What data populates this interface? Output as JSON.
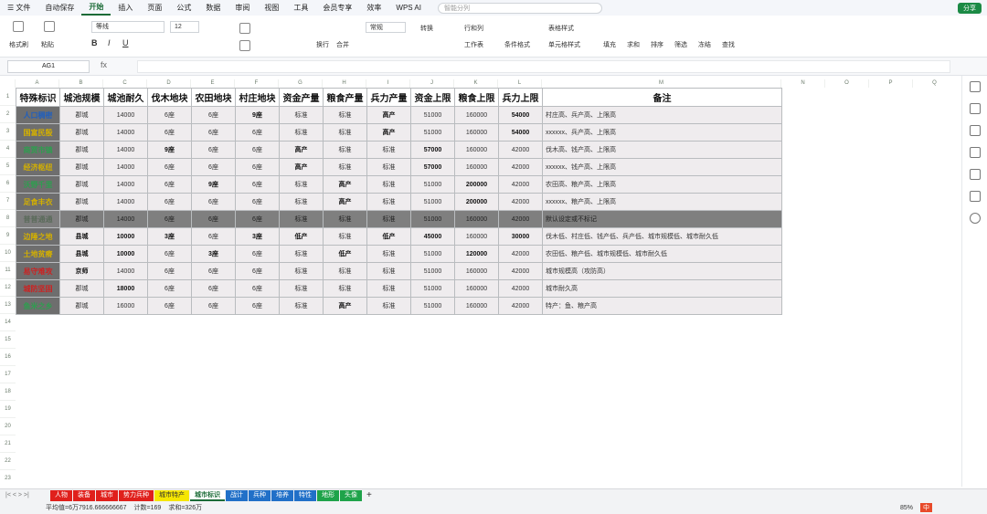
{
  "menubar": {
    "items": [
      "☰ 文件",
      "自动保存",
      "开始",
      "插入",
      "页面",
      "公式",
      "数据",
      "审阅",
      "视图",
      "工具",
      "会员专享",
      "效率",
      "WPS AI"
    ],
    "search_placeholder": "智能分列",
    "share_label": "分享"
  },
  "ribbon": {
    "format_painter": "格式刷",
    "paste": "粘贴",
    "font_name": "等线",
    "font_size": "12",
    "wrap": "换行",
    "merge": "合并",
    "number_format": "常规",
    "convert": "转换",
    "rows_cols": "行和列",
    "worksheet": "工作表",
    "cond_format": "条件格式",
    "table_style": "表格样式",
    "cell_style": "单元格样式",
    "fill": "填充",
    "sum": "求和",
    "sort": "排序",
    "filter": "筛选",
    "freeze": "冻结",
    "find": "查找"
  },
  "formula": {
    "cell_ref": "AG1",
    "fx": "fx"
  },
  "columns": [
    "A",
    "B",
    "C",
    "D",
    "E",
    "F",
    "G",
    "H",
    "I",
    "J",
    "K",
    "L",
    "M",
    "N",
    "O",
    "P",
    "Q"
  ],
  "headers": [
    "特殊标识",
    "城池规模",
    "城池耐久",
    "伐木地块",
    "农田地块",
    "村庄地块",
    "资金产量",
    "粮食产量",
    "兵力产量",
    "资金上限",
    "粮食上限",
    "兵力上限",
    "备注"
  ],
  "rows": [
    {
      "tag": "人口稠密",
      "tag_color": "#1f5fbf",
      "cells": [
        "郡城",
        "14000",
        "6座",
        "6座",
        "9座",
        "标准",
        "标准",
        "高产",
        "51000",
        "160000",
        "54000"
      ],
      "bold": [
        4,
        7,
        10
      ],
      "note": "村庄高、兵产高、上限高"
    },
    {
      "tag": "国富民殷",
      "tag_color": "#d4b000",
      "cells": [
        "郡城",
        "14000",
        "6座",
        "6座",
        "6座",
        "标准",
        "标准",
        "高产",
        "51000",
        "160000",
        "54000"
      ],
      "bold": [
        7,
        10
      ],
      "note": "xxxxxx、兵产高、上限高"
    },
    {
      "tag": "商贾市镇",
      "tag_color": "#2e9e4f",
      "cells": [
        "郡城",
        "14000",
        "9座",
        "6座",
        "6座",
        "高产",
        "标准",
        "标准",
        "57000",
        "160000",
        "42000"
      ],
      "bold": [
        2,
        5,
        8
      ],
      "note": "伐木高、钱产高、上限高"
    },
    {
      "tag": "经济枢纽",
      "tag_color": "#d4b000",
      "cells": [
        "郡城",
        "14000",
        "6座",
        "6座",
        "6座",
        "高产",
        "标准",
        "标准",
        "57000",
        "160000",
        "42000"
      ],
      "bold": [
        5,
        8
      ],
      "note": "xxxxxx、钱产高、上限高"
    },
    {
      "tag": "沃野千里",
      "tag_color": "#2e9e4f",
      "cells": [
        "郡城",
        "14000",
        "6座",
        "9座",
        "6座",
        "标准",
        "高产",
        "标准",
        "51000",
        "200000",
        "42000"
      ],
      "bold": [
        3,
        6,
        9
      ],
      "note": "农田高、粮产高、上限高"
    },
    {
      "tag": "足食丰衣",
      "tag_color": "#d4b000",
      "cells": [
        "郡城",
        "14000",
        "6座",
        "6座",
        "6座",
        "标准",
        "高产",
        "标准",
        "51000",
        "200000",
        "42000"
      ],
      "bold": [
        6,
        9
      ],
      "note": "xxxxxx、粮产高、上限高"
    },
    {
      "tag": "普普通通",
      "tag_color": "#5b6b5b",
      "dark": true,
      "cells": [
        "郡城",
        "14000",
        "6座",
        "6座",
        "6座",
        "标准",
        "标准",
        "标准",
        "51000",
        "160000",
        "42000"
      ],
      "bold": [],
      "note": "默认设定或不标记"
    },
    {
      "tag": "边陲之地",
      "tag_color": "#d4b000",
      "cells": [
        "县城",
        "10000",
        "3座",
        "6座",
        "3座",
        "低产",
        "标准",
        "低产",
        "45000",
        "160000",
        "30000"
      ],
      "bold": [
        0,
        1,
        2,
        4,
        5,
        7,
        8,
        10
      ],
      "note": "伐木低、村庄低、钱产低、兵产低、城市规模低、城市耐久低"
    },
    {
      "tag": "土地贫瘠",
      "tag_color": "#d4b000",
      "cells": [
        "县城",
        "10000",
        "6座",
        "3座",
        "6座",
        "标准",
        "低产",
        "标准",
        "51000",
        "120000",
        "42000"
      ],
      "bold": [
        0,
        1,
        3,
        6,
        9
      ],
      "note": "农田低、粮产低、城市规模低、城市耐久低"
    },
    {
      "tag": "易守难攻",
      "tag_color": "#cc2222",
      "cells": [
        "京师",
        "14000",
        "6座",
        "6座",
        "6座",
        "标准",
        "标准",
        "标准",
        "51000",
        "160000",
        "42000"
      ],
      "bold": [
        0
      ],
      "note": "城市规模高（攻防高）"
    },
    {
      "tag": "城防坚固",
      "tag_color": "#cc2222",
      "cells": [
        "郡城",
        "18000",
        "6座",
        "6座",
        "6座",
        "标准",
        "标准",
        "标准",
        "51000",
        "160000",
        "42000"
      ],
      "bold": [
        1
      ],
      "note": "城市耐久高"
    },
    {
      "tag": "鱼米之乡",
      "tag_color": "#2e9e4f",
      "cells": [
        "郡城",
        "16000",
        "6座",
        "6座",
        "6座",
        "标准",
        "高产",
        "标准",
        "51000",
        "160000",
        "42000"
      ],
      "bold": [
        6
      ],
      "note": "特产：鱼、粮产高"
    }
  ],
  "row_numbers": [
    "1",
    "2",
    "3",
    "4",
    "5",
    "6",
    "7",
    "8",
    "9",
    "10",
    "11",
    "12",
    "13",
    "14",
    "15",
    "16",
    "17",
    "18",
    "19",
    "20",
    "21",
    "22",
    "23"
  ],
  "tabs": [
    {
      "label": "人物",
      "bg": "#e0201c",
      "fg": "#fff"
    },
    {
      "label": "装备",
      "bg": "#e0201c",
      "fg": "#fff"
    },
    {
      "label": "城市",
      "bg": "#e0201c",
      "fg": "#fff"
    },
    {
      "label": "势力兵种",
      "bg": "#e0201c",
      "fg": "#fff"
    },
    {
      "label": "城市特产",
      "bg": "#f5e600",
      "fg": "#333"
    },
    {
      "label": "城市标识",
      "bg": "#ffffff",
      "fg": "#1b6b37"
    },
    {
      "label": "战计",
      "bg": "#2170c8",
      "fg": "#fff"
    },
    {
      "label": "兵种",
      "bg": "#2170c8",
      "fg": "#fff"
    },
    {
      "label": "培养",
      "bg": "#2170c8",
      "fg": "#fff"
    },
    {
      "label": "特性",
      "bg": "#2170c8",
      "fg": "#fff"
    },
    {
      "label": "地形",
      "bg": "#1fa34a",
      "fg": "#fff"
    },
    {
      "label": "头像",
      "bg": "#1fa34a",
      "fg": "#fff"
    }
  ],
  "status": {
    "average": "平均值=6万7916.666666667",
    "count": "计数=169",
    "sum": "求和=326万",
    "zoom": "85%",
    "ime": "中"
  }
}
